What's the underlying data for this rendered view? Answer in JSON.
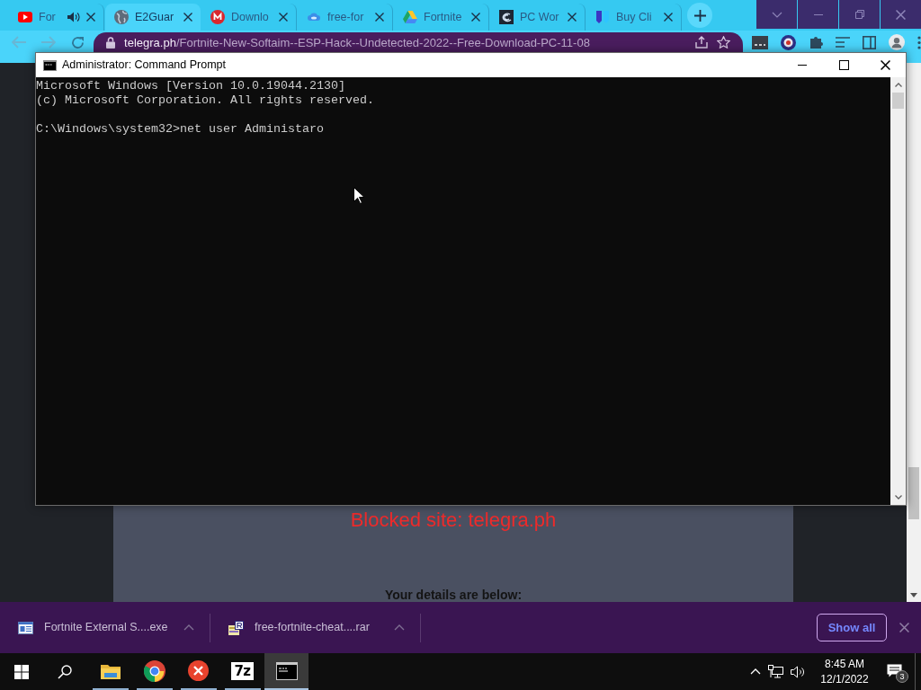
{
  "browser": {
    "tabs": [
      {
        "title": "For",
        "kind": "play",
        "audio": true,
        "selected": false
      },
      {
        "title": "E2Guar",
        "kind": "globe",
        "audio": false,
        "selected": true
      },
      {
        "title": "Downlo",
        "kind": "mega",
        "audio": false,
        "selected": false
      },
      {
        "title": "free-for",
        "kind": "cloud",
        "audio": false,
        "selected": false
      },
      {
        "title": "Fortnite",
        "kind": "drive",
        "audio": false,
        "selected": false
      },
      {
        "title": "PC Wor",
        "kind": "pcw",
        "audio": false,
        "selected": false
      },
      {
        "title": "Buy Cli",
        "kind": "shield",
        "audio": false,
        "selected": false
      }
    ],
    "address_bar": {
      "domain": "telegra.ph",
      "path": "/Fortnite-New-Softaim--ESP-Hack--Undetected-2022--Free-Download-PC-11-08"
    },
    "page": {
      "heading": "Blocked site: telegra.ph",
      "subheading": "Your details are below:"
    },
    "downloads": [
      {
        "name": "Fortnite External S....exe",
        "kind": "exe"
      },
      {
        "name": "free-fortnite-cheat....rar",
        "kind": "rar"
      }
    ],
    "show_all_button": "Show all"
  },
  "console_window": {
    "title": "Administrator: Command Prompt",
    "output": [
      "Microsoft Windows [Version 10.0.19044.2130]",
      "(c) Microsoft Corporation. All rights reserved."
    ],
    "prompt": "C:\\Windows\\system32>",
    "command": "net user Administaro"
  },
  "taskbar": {
    "apps": [
      {
        "kind": "explorer",
        "running": true,
        "selected": false
      },
      {
        "kind": "chrome",
        "running": true,
        "selected": false
      },
      {
        "kind": "error",
        "running": true,
        "selected": false
      },
      {
        "kind": "archiver",
        "label": "7z",
        "running": true,
        "selected": false
      },
      {
        "kind": "console",
        "running": true,
        "selected": true
      }
    ],
    "clock": {
      "time": "8:45 AM",
      "date": "12/1/2022"
    },
    "notification_count": "3"
  }
}
